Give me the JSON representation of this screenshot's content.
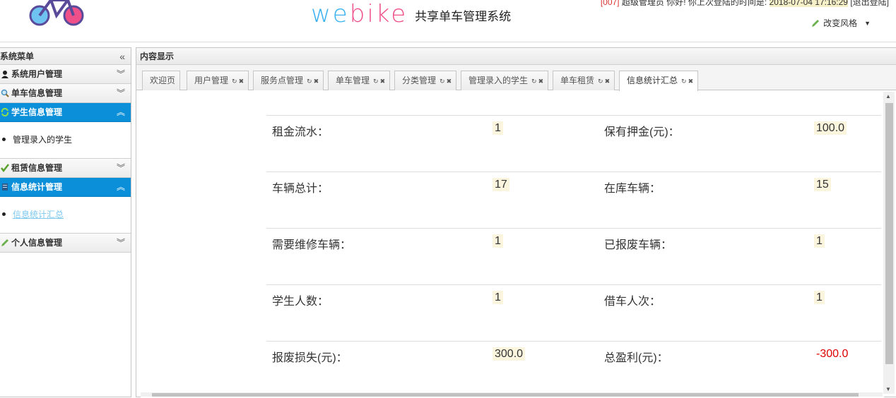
{
  "header": {
    "brand_en_a": "we",
    "brand_en_b": "bike",
    "brand_cn": "共享单车管理系统",
    "user_id": "[007]",
    "user_greeting": " 超级管理员 你好! 你上次登陆的时间是: ",
    "last_login": "2018-07-04 17:16:29",
    "logout": " [退出登陆]",
    "style_switch": "改变风格"
  },
  "sidebar": {
    "title": "系统菜单",
    "groups": [
      {
        "label": "系统用户管理",
        "icon": "user-icon",
        "active": false
      },
      {
        "label": "单车信息管理",
        "icon": "magnifier-icon",
        "active": false
      },
      {
        "label": "学生信息管理",
        "icon": "refresh-icon",
        "active": true,
        "item": "管理录入的学生"
      },
      {
        "label": "租赁信息管理",
        "icon": "checkmark-icon",
        "active": false
      },
      {
        "label": "信息统计管理",
        "icon": "notepad-icon",
        "active": true,
        "item": "信息统计汇总"
      },
      {
        "label": "个人信息管理",
        "icon": "pencil-icon",
        "active": false
      }
    ]
  },
  "main": {
    "title": "内容显示",
    "tabs": [
      {
        "label": "欢迎页",
        "closable": false
      },
      {
        "label": "用户管理",
        "closable": true
      },
      {
        "label": "服务点管理",
        "closable": true
      },
      {
        "label": "单车管理",
        "closable": true
      },
      {
        "label": "分类管理",
        "closable": true
      },
      {
        "label": "管理录入的学生",
        "closable": true
      },
      {
        "label": "单车租赁",
        "closable": true
      },
      {
        "label": "信息统计汇总",
        "closable": true,
        "active": true
      }
    ],
    "stats": [
      {
        "l1": "租金流水：",
        "v1": "1",
        "l2": "保有押金(元)：",
        "v2": "100.0"
      },
      {
        "l1": "车辆总计：",
        "v1": "17",
        "l2": "在库车辆：",
        "v2": "15"
      },
      {
        "l1": "需要维修车辆：",
        "v1": "1",
        "l2": "已报废车辆：",
        "v2": "1"
      },
      {
        "l1": "学生人数：",
        "v1": "1",
        "l2": "借车人次：",
        "v2": "1"
      },
      {
        "l1": "报废损失(元)：",
        "v1": "300.0",
        "l2": "总盈利(元)：",
        "v2": "-300.0"
      }
    ]
  },
  "colors": {
    "accent": "#0a8fd8",
    "negative": "#dd0000",
    "brand_blue": "#3ab0f0",
    "brand_pink": "#f0508a"
  }
}
